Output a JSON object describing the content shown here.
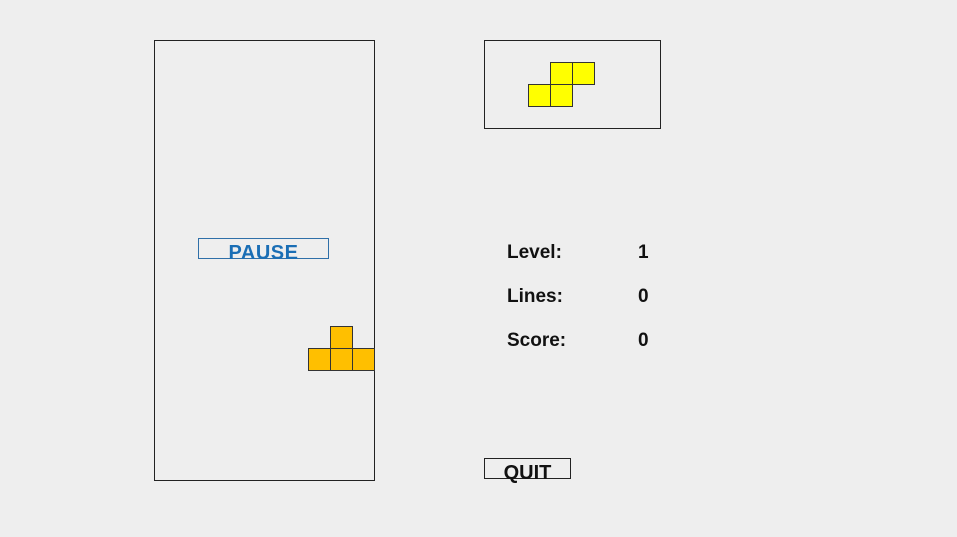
{
  "controls": {
    "pause_label": "PAUSE",
    "quit_label": "QUIT"
  },
  "stats": {
    "level_label": "Level:",
    "level_value": "1",
    "lines_label": "Lines:",
    "lines_value": "0",
    "score_label": "Score:",
    "score_value": "0"
  },
  "colors": {
    "falling_piece": "#ffbf00",
    "next_piece": "#ffff00",
    "pause_text": "#1a6eb5",
    "background": "#eeeeee"
  },
  "pieces": {
    "falling_piece_shape": "T",
    "next_piece_shape": "S"
  }
}
